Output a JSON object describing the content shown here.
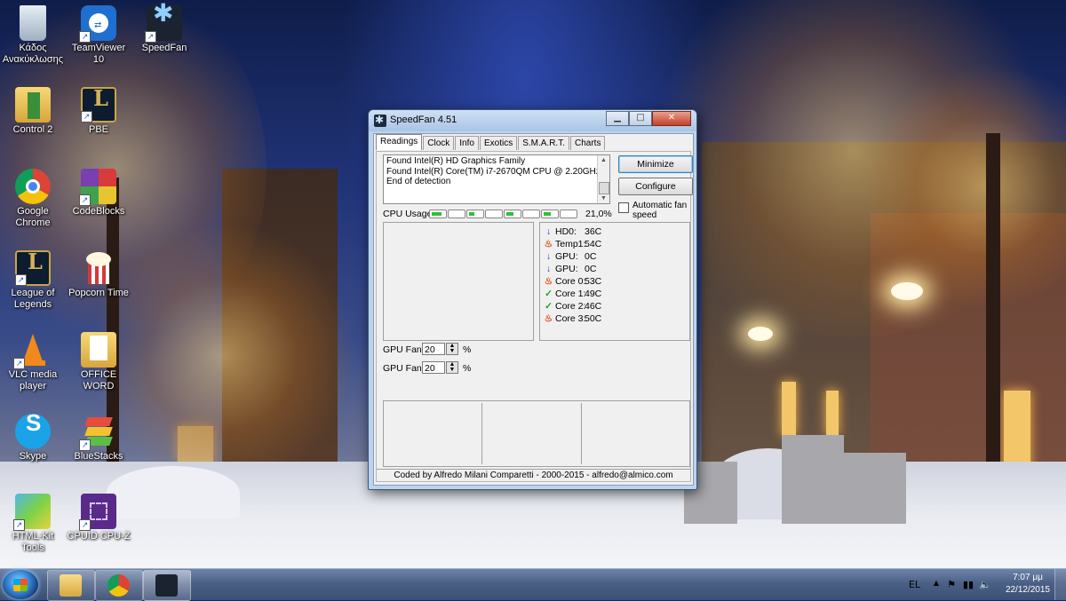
{
  "desktop": {
    "icons": [
      {
        "label": "Κάδος\nΑνακύκλωσης",
        "icon": "recycle-bin-icon"
      },
      {
        "label": "TeamViewer 10",
        "icon": "teamviewer-icon"
      },
      {
        "label": "SpeedFan",
        "icon": "speedfan-icon"
      },
      {
        "label": "Control 2",
        "icon": "folder-icon"
      },
      {
        "label": "PBE",
        "icon": "league-pbe-icon"
      },
      {
        "label": "Google\nChrome",
        "icon": "chrome-icon"
      },
      {
        "label": "CodeBlocks",
        "icon": "codeblocks-icon"
      },
      {
        "label": "League of\nLegends",
        "icon": "league-icon"
      },
      {
        "label": "Popcorn Time",
        "icon": "popcorn-icon"
      },
      {
        "label": "VLC media\nplayer",
        "icon": "vlc-icon"
      },
      {
        "label": "OFFICE WORD",
        "icon": "folder-icon"
      },
      {
        "label": "Skype",
        "icon": "skype-icon"
      },
      {
        "label": "BlueStacks",
        "icon": "bluestacks-icon"
      },
      {
        "label": "HTML-Kit\nTools",
        "icon": "htmlkit-icon"
      },
      {
        "label": "CPUID CPU-Z",
        "icon": "cpuz-icon"
      }
    ]
  },
  "window": {
    "title": "SpeedFan 4.51",
    "caption": {
      "minimize": "▁",
      "maximize": "□",
      "close": "✕"
    },
    "tabs": [
      "Readings",
      "Clock",
      "Info",
      "Exotics",
      "S.M.A.R.T.",
      "Charts"
    ],
    "log_lines": [
      "Found Intel(R) HD Graphics Family",
      "Found Intel(R) Core(TM) i7-2670QM CPU @ 2.20GHz",
      "End of detection"
    ],
    "minimize_label": "Minimize",
    "configure_label": "Configure",
    "auto_fan_label": "Automatic fan speed",
    "auto_fan_checked": false,
    "cpu_usage_label": "CPU Usage",
    "cpu_usage_value": "21,0%",
    "cpu_core_loads": [
      0.75,
      0.0,
      0.45,
      0.0,
      0.55,
      0.0,
      0.55,
      0.0
    ],
    "readings": [
      {
        "name": "HD0:",
        "value": "36C",
        "status": "down"
      },
      {
        "name": "Temp1:",
        "value": "54C",
        "status": "fire"
      },
      {
        "name": "GPU:",
        "value": "0C",
        "status": "down"
      },
      {
        "name": "GPU:",
        "value": "0C",
        "status": "down"
      },
      {
        "name": "Core 0:",
        "value": "53C",
        "status": "fire"
      },
      {
        "name": "Core 1:",
        "value": "49C",
        "status": "ok"
      },
      {
        "name": "Core 2:",
        "value": "46C",
        "status": "ok"
      },
      {
        "name": "Core 3:",
        "value": "50C",
        "status": "fire"
      }
    ],
    "fans": [
      {
        "label": "GPU Fan:",
        "value": "20",
        "unit": "%"
      },
      {
        "label": "GPU Fan:",
        "value": "20",
        "unit": "%"
      }
    ],
    "status_text": "Coded by Alfredo Milani Comparetti - 2000-2015 - alfredo@almico.com"
  },
  "taskbar": {
    "apps": [
      "windows-explorer",
      "google-chrome",
      "speedfan"
    ],
    "language": "EL",
    "time": "7:07 μμ",
    "date": "22/12/2015"
  }
}
